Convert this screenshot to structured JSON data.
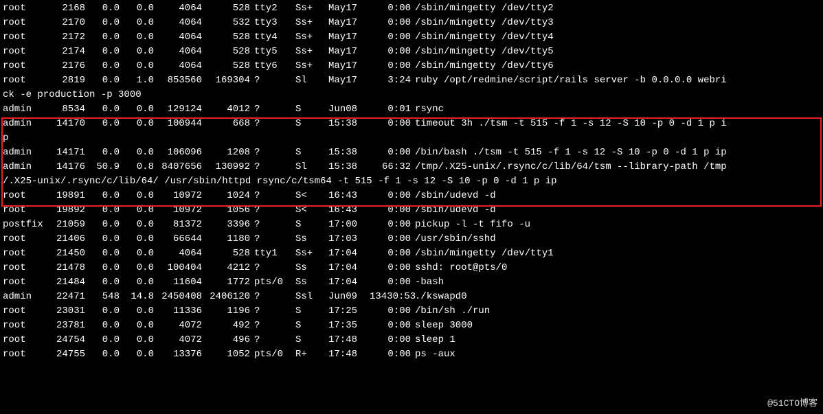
{
  "watermark": "@51CTO博客",
  "highlight": {
    "from": 7,
    "to": 11
  },
  "rows": [
    {
      "user": "root",
      "pid": "2168",
      "cpu": "0.0",
      "mem": "0.0",
      "vsz": "4064",
      "rss": "528",
      "tty": "tty2",
      "stat": "Ss+",
      "start": "May17",
      "time": "0:00",
      "cmd": "/sbin/mingetty /dev/tty2"
    },
    {
      "user": "root",
      "pid": "2170",
      "cpu": "0.0",
      "mem": "0.0",
      "vsz": "4064",
      "rss": "532",
      "tty": "tty3",
      "stat": "Ss+",
      "start": "May17",
      "time": "0:00",
      "cmd": "/sbin/mingetty /dev/tty3"
    },
    {
      "user": "root",
      "pid": "2172",
      "cpu": "0.0",
      "mem": "0.0",
      "vsz": "4064",
      "rss": "528",
      "tty": "tty4",
      "stat": "Ss+",
      "start": "May17",
      "time": "0:00",
      "cmd": "/sbin/mingetty /dev/tty4"
    },
    {
      "user": "root",
      "pid": "2174",
      "cpu": "0.0",
      "mem": "0.0",
      "vsz": "4064",
      "rss": "528",
      "tty": "tty5",
      "stat": "Ss+",
      "start": "May17",
      "time": "0:00",
      "cmd": "/sbin/mingetty /dev/tty5"
    },
    {
      "user": "root",
      "pid": "2176",
      "cpu": "0.0",
      "mem": "0.0",
      "vsz": "4064",
      "rss": "528",
      "tty": "tty6",
      "stat": "Ss+",
      "start": "May17",
      "time": "0:00",
      "cmd": "/sbin/mingetty /dev/tty6"
    },
    {
      "user": "root",
      "pid": "2819",
      "cpu": "0.0",
      "mem": "1.0",
      "vsz": "853560",
      "rss": "169304",
      "tty": "?",
      "stat": "Sl",
      "start": "May17",
      "time": "3:24",
      "cmd": "ruby /opt/redmine/script/rails server -b 0.0.0.0 webri",
      "wrap": "ck -e production -p 3000"
    },
    {
      "user": "admin",
      "pid": "8534",
      "cpu": "0.0",
      "mem": "0.0",
      "vsz": "129124",
      "rss": "4012",
      "tty": "?",
      "stat": "S",
      "start": "Jun08",
      "time": "0:01",
      "cmd": "rsync"
    },
    {
      "user": "admin",
      "pid": "14170",
      "cpu": "0.0",
      "mem": "0.0",
      "vsz": "100944",
      "rss": "668",
      "tty": "?",
      "stat": "S",
      "start": "15:38",
      "time": "0:00",
      "cmd": "timeout 3h ./tsm -t 515 -f 1 -s 12 -S 10 -p 0 -d 1 p i",
      "wrap": "p"
    },
    {
      "user": "admin",
      "pid": "14171",
      "cpu": "0.0",
      "mem": "0.0",
      "vsz": "106096",
      "rss": "1208",
      "tty": "?",
      "stat": "S",
      "start": "15:38",
      "time": "0:00",
      "cmd": "/bin/bash ./tsm -t 515 -f 1 -s 12 -S 10 -p 0 -d 1 p ip"
    },
    {
      "user": "admin",
      "pid": "14176",
      "cpu": "50.9",
      "mem": "0.8",
      "vsz": "8407656",
      "rss": "130992",
      "tty": "?",
      "stat": "Sl",
      "start": "15:38",
      "time": "66:32",
      "cmd": "/tmp/.X25-unix/.rsync/c/lib/64/tsm --library-path /tmp",
      "wrap": "/.X25-unix/.rsync/c/lib/64/ /usr/sbin/httpd rsync/c/tsm64 -t 515 -f 1 -s 12 -S 10 -p 0 -d 1 p ip"
    },
    {
      "user": "root",
      "pid": "19891",
      "cpu": "0.0",
      "mem": "0.0",
      "vsz": "10972",
      "rss": "1024",
      "tty": "?",
      "stat": "S<",
      "start": "16:43",
      "time": "0:00",
      "cmd": "/sbin/udevd -d"
    },
    {
      "user": "root",
      "pid": "19892",
      "cpu": "0.0",
      "mem": "0.0",
      "vsz": "10972",
      "rss": "1056",
      "tty": "?",
      "stat": "S<",
      "start": "16:43",
      "time": "0:00",
      "cmd": "/sbin/udevd -d"
    },
    {
      "user": "postfix",
      "pid": "21059",
      "cpu": "0.0",
      "mem": "0.0",
      "vsz": "81372",
      "rss": "3396",
      "tty": "?",
      "stat": "S",
      "start": "17:00",
      "time": "0:00",
      "cmd": "pickup -l -t fifo -u"
    },
    {
      "user": "root",
      "pid": "21406",
      "cpu": "0.0",
      "mem": "0.0",
      "vsz": "66644",
      "rss": "1180",
      "tty": "?",
      "stat": "Ss",
      "start": "17:03",
      "time": "0:00",
      "cmd": "/usr/sbin/sshd"
    },
    {
      "user": "root",
      "pid": "21450",
      "cpu": "0.0",
      "mem": "0.0",
      "vsz": "4064",
      "rss": "528",
      "tty": "tty1",
      "stat": "Ss+",
      "start": "17:04",
      "time": "0:00",
      "cmd": "/sbin/mingetty /dev/tty1"
    },
    {
      "user": "root",
      "pid": "21478",
      "cpu": "0.0",
      "mem": "0.0",
      "vsz": "100404",
      "rss": "4212",
      "tty": "?",
      "stat": "Ss",
      "start": "17:04",
      "time": "0:00",
      "cmd": "sshd: root@pts/0"
    },
    {
      "user": "root",
      "pid": "21484",
      "cpu": "0.0",
      "mem": "0.0",
      "vsz": "11604",
      "rss": "1772",
      "tty": "pts/0",
      "stat": "Ss",
      "start": "17:04",
      "time": "0:00",
      "cmd": "-bash"
    },
    {
      "user": "admin",
      "pid": "22471",
      "cpu": "548",
      "mem": "14.8",
      "vsz": "2450408",
      "rss": "2406120",
      "tty": "?",
      "stat": "Ssl",
      "start": "Jun09",
      "time": "13430:53",
      "cmd": "./kswapd0"
    },
    {
      "user": "root",
      "pid": "23031",
      "cpu": "0.0",
      "mem": "0.0",
      "vsz": "11336",
      "rss": "1196",
      "tty": "?",
      "stat": "S",
      "start": "17:25",
      "time": "0:00",
      "cmd": "/bin/sh ./run"
    },
    {
      "user": "root",
      "pid": "23781",
      "cpu": "0.0",
      "mem": "0.0",
      "vsz": "4072",
      "rss": "492",
      "tty": "?",
      "stat": "S",
      "start": "17:35",
      "time": "0:00",
      "cmd": "sleep 3000"
    },
    {
      "user": "root",
      "pid": "24754",
      "cpu": "0.0",
      "mem": "0.0",
      "vsz": "4072",
      "rss": "496",
      "tty": "?",
      "stat": "S",
      "start": "17:48",
      "time": "0:00",
      "cmd": "sleep 1"
    },
    {
      "user": "root",
      "pid": "24755",
      "cpu": "0.0",
      "mem": "0.0",
      "vsz": "13376",
      "rss": "1052",
      "tty": "pts/0",
      "stat": "R+",
      "start": "17:48",
      "time": "0:00",
      "cmd": "ps -aux"
    }
  ]
}
